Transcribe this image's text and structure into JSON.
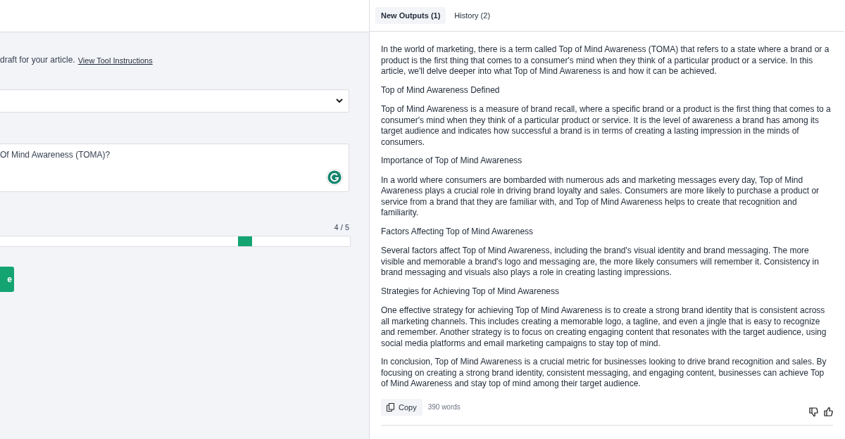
{
  "form": {
    "intro": "draft for your article.",
    "instructions_link": "View Tool Instructions",
    "question": {
      "value": "Of Mind Awareness (TOMA)?"
    },
    "slider": {
      "reading": "4 / 5",
      "level": 0.7
    },
    "submit_button": "e"
  },
  "output_tabs": [
    {
      "label": "New Outputs (1)",
      "selected": true
    },
    {
      "label": "History (2)",
      "selected": false
    }
  ],
  "output": {
    "paragraphs": [
      {
        "kind": "body",
        "text": "In the world of marketing, there is a term called Top of Mind Awareness (TOMA) that refers to a state where a brand or a product is the first thing that comes to a consumer's mind when they think of a particular product or a service. In this article, we'll delve deeper into what Top of Mind Awareness is and how it can be achieved."
      },
      {
        "kind": "heading",
        "text": "Top of Mind Awareness Defined"
      },
      {
        "kind": "body",
        "text": "Top of Mind Awareness is a measure of brand recall, where a specific brand or a product is the first thing that comes to a consumer's mind when they think of a particular product or service. It is the level of awareness a brand has among its target audience and indicates how successful a brand is in terms of creating a lasting impression in the minds of consumers."
      },
      {
        "kind": "heading",
        "text": "Importance of Top of Mind Awareness"
      },
      {
        "kind": "body",
        "text": "In a world where consumers are bombarded with numerous ads and marketing messages every day, Top of Mind Awareness plays a crucial role in driving brand loyalty and sales. Consumers are more likely to purchase a product or service from a brand that they are familiar with, and Top of Mind Awareness helps to create that recognition and familiarity."
      },
      {
        "kind": "heading",
        "text": "Factors Affecting Top of Mind Awareness"
      },
      {
        "kind": "body",
        "text": "Several factors affect Top of Mind Awareness, including the brand's visual identity and brand messaging. The more visible and memorable a brand's logo and messaging are, the more likely consumers will remember it. Consistency in brand messaging and visuals also plays a role in creating lasting impressions."
      },
      {
        "kind": "heading",
        "text": "Strategies for Achieving Top of Mind Awareness"
      },
      {
        "kind": "body",
        "text": "One effective strategy for achieving Top of Mind Awareness is to create a strong brand identity that is consistent across all marketing channels. This includes creating a memorable logo, a tagline, and even a jingle that is easy to recognize and remember. Another strategy is to focus on creating engaging content that resonates with the target audience, using social media platforms and email marketing campaigns to stay top of mind."
      },
      {
        "kind": "body",
        "text": "In conclusion, Top of Mind Awareness is a crucial metric for businesses looking to drive brand recognition and sales. By focusing on creating a strong brand identity, consistent messaging, and engaging content, businesses can achieve Top of Mind Awareness and stay top of mind among their target audience."
      }
    ],
    "copy_button": "Copy",
    "word_count": "390 words"
  }
}
